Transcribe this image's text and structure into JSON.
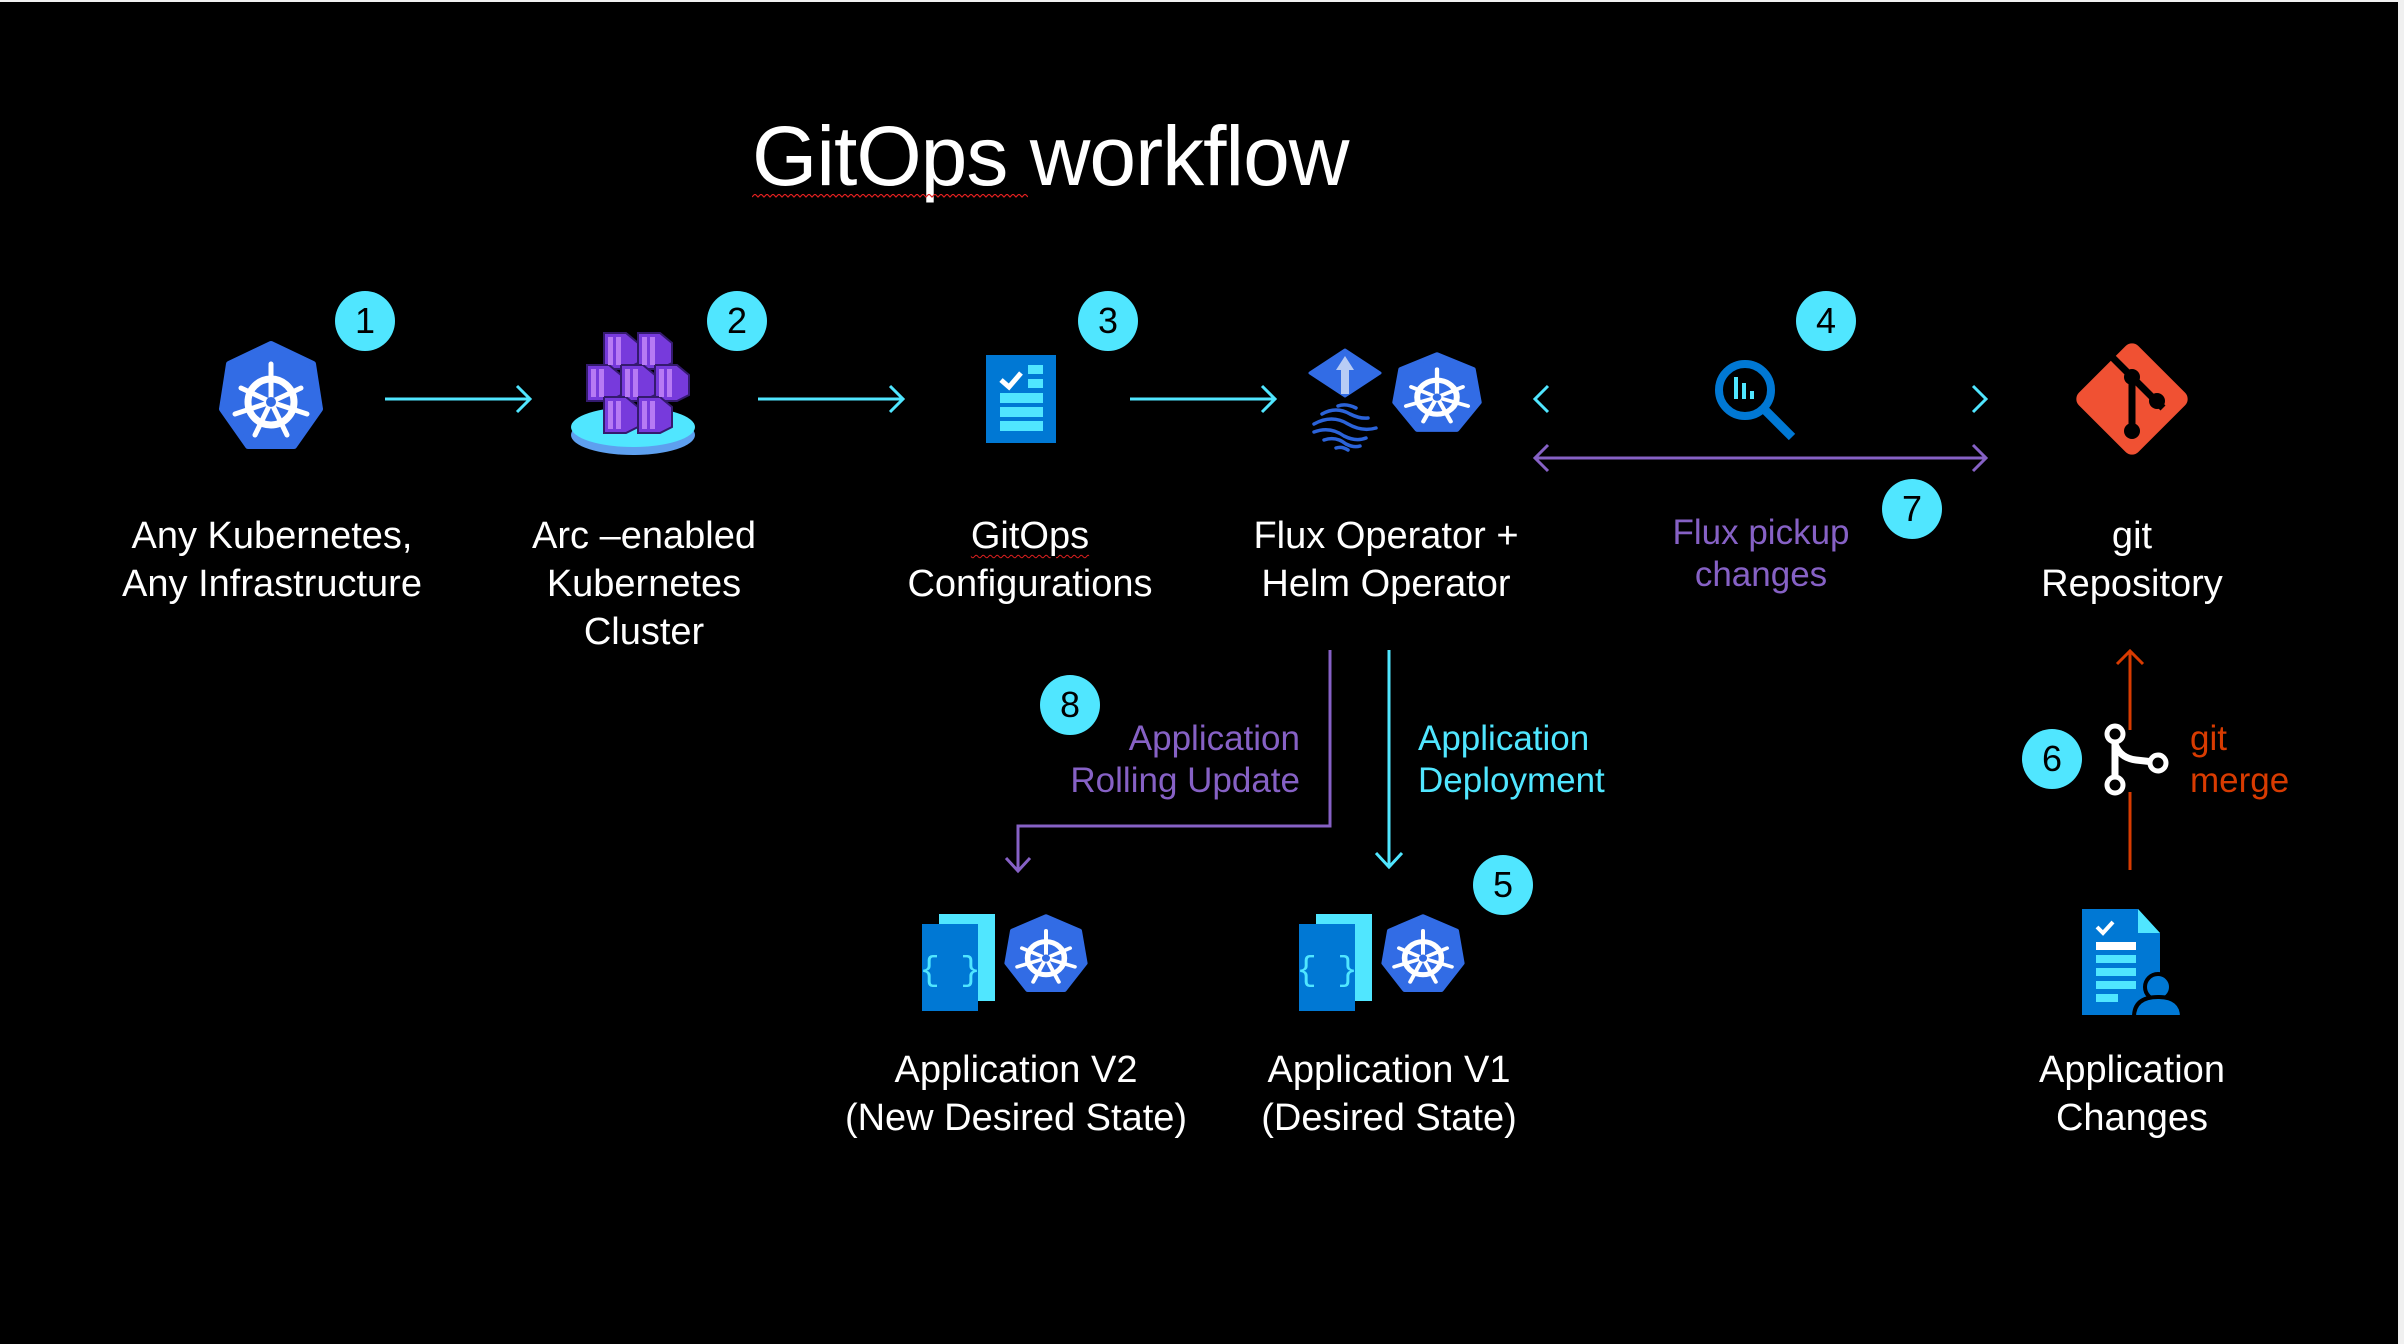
{
  "title": "GitOps workflow",
  "colors": {
    "background": "#000000",
    "text": "#ffffff",
    "badge": "#50e6ff",
    "flow_cyan": "#50e6ff",
    "flow_purple": "#8661c5",
    "flow_orange": "#d83b01",
    "kubernetes_blue": "#326ce5",
    "azure_blue": "#0078d4",
    "git_orange": "#f05133"
  },
  "nodes": [
    {
      "id": "any-kubernetes",
      "icon": "kubernetes-icon",
      "lines": [
        "Any Kubernetes,",
        "Any Infrastructure"
      ]
    },
    {
      "id": "arc-cluster",
      "icon": "azure-arc-kubernetes-icon",
      "lines": [
        "Arc –enabled",
        "Kubernetes",
        "Cluster"
      ]
    },
    {
      "id": "gitops-config",
      "icon": "configuration-checklist-icon",
      "lines": [
        "GitOps",
        "Configurations"
      ]
    },
    {
      "id": "flux-helm",
      "icon": "flux-operator-icon + kubernetes-icon",
      "lines": [
        "Flux Operator +",
        "Helm Operator"
      ]
    },
    {
      "id": "git-repo",
      "icon": "git-icon",
      "lines": [
        "git",
        "Repository"
      ]
    },
    {
      "id": "app-v2",
      "icon": "code-document-icon + kubernetes-icon",
      "lines": [
        "Application V2",
        "(New Desired State)"
      ]
    },
    {
      "id": "app-v1",
      "icon": "code-document-icon + kubernetes-icon",
      "lines": [
        "Application V1",
        "(Desired State)"
      ]
    },
    {
      "id": "app-changes",
      "icon": "document-user-icon",
      "lines": [
        "Application",
        "Changes"
      ]
    }
  ],
  "steps": [
    "1",
    "2",
    "3",
    "4",
    "5",
    "6",
    "7",
    "8"
  ],
  "edge_labels": {
    "flux_pickup": [
      "Flux pickup",
      "changes"
    ],
    "rolling_update": [
      "Application",
      "Rolling Update"
    ],
    "deployment": [
      "Application",
      "Deployment"
    ],
    "git_merge": [
      "git",
      "merge"
    ]
  },
  "icons": {
    "monitor": "magnifier-chart-icon",
    "merge": "git-merge-icon"
  }
}
